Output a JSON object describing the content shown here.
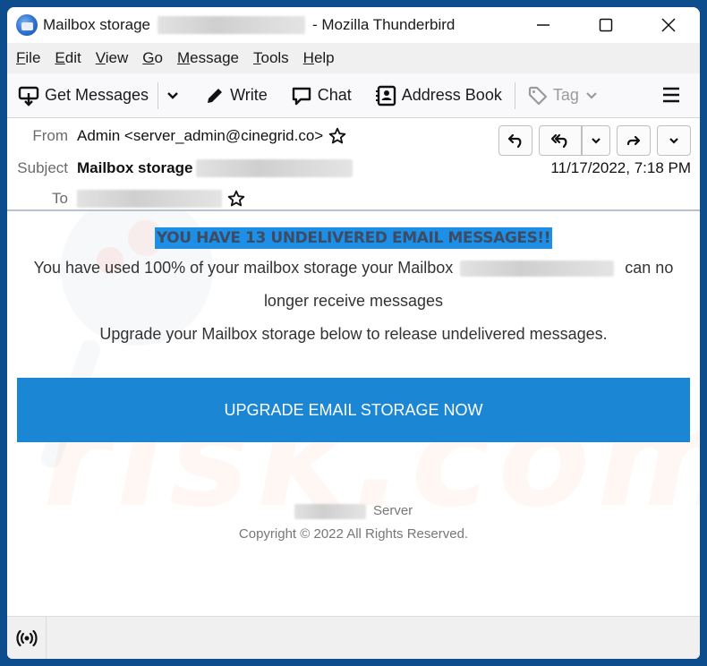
{
  "window": {
    "title_prefix": "Mailbox storage",
    "title_suffix": "- Mozilla Thunderbird",
    "controls": {
      "minimize": "—",
      "maximize": "☐",
      "close": "✕"
    }
  },
  "menubar": {
    "items": [
      {
        "accel": "F",
        "rest": "ile"
      },
      {
        "accel": "E",
        "rest": "dit"
      },
      {
        "accel": "V",
        "rest": "iew"
      },
      {
        "accel": "G",
        "rest": "o"
      },
      {
        "accel": "M",
        "rest": "essage"
      },
      {
        "accel": "T",
        "rest": "ools"
      },
      {
        "accel": "H",
        "rest": "elp"
      }
    ]
  },
  "toolbar": {
    "get_messages": "Get Messages",
    "write": "Write",
    "chat": "Chat",
    "address_book": "Address Book",
    "tag": "Tag"
  },
  "header": {
    "from_label": "From",
    "from_value": "Admin <server_admin@cinegrid.co>",
    "subject_label": "Subject",
    "subject_value": "Mailbox storage",
    "to_label": "To",
    "date": "11/17/2022, 7:18 PM"
  },
  "body": {
    "alert": "YOU HAVE 13 UNDELIVERED EMAIL MESSAGES!!",
    "line1_a": "You have used 100% of your mailbox storage your Mailbox",
    "line1_b": "can no",
    "line2": "longer receive messages",
    "line3": "Upgrade your Mailbox storage below to release undelivered messages.",
    "cta": "UPGRADE EMAIL STORAGE NOW",
    "footer_server": "Server",
    "footer_copyright": "Copyright © 2022 All Rights Reserved."
  },
  "watermark": "risk.com",
  "colors": {
    "alert_highlight": "#1e8fe6",
    "cta_background": "#1b86d4",
    "window_frame": "#0d4d8e"
  }
}
